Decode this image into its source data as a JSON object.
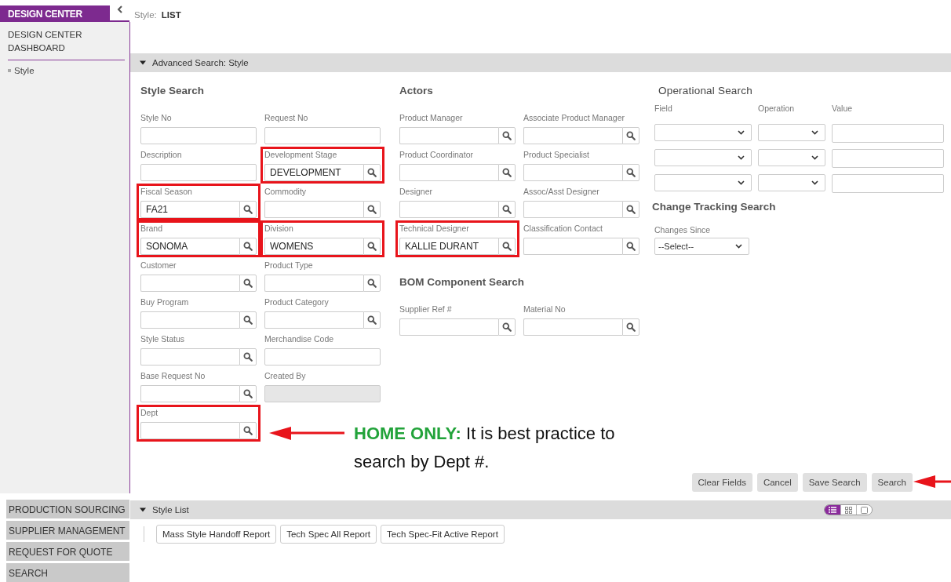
{
  "sidebar": {
    "title": "DESIGN CENTER",
    "collapsed": false,
    "items": [
      {
        "label": "DESIGN CENTER DASHBOARD",
        "kind": "link"
      },
      {
        "label": "Style",
        "kind": "bullet"
      }
    ],
    "sections": [
      "PRODUCTION SOURCING",
      "SUPPLIER MANAGEMENT",
      "REQUEST FOR QUOTE",
      "SEARCH"
    ]
  },
  "page_title": {
    "label": "Style:",
    "value": "LIST"
  },
  "advanced_search": {
    "title": "Advanced Search: Style",
    "expanded": true,
    "style_search": {
      "title": "Style Search",
      "fields": [
        {
          "label": "Style No",
          "kind": "text",
          "highlighted": false
        },
        {
          "label": "Request No",
          "kind": "text",
          "highlighted": false
        },
        {
          "label": "Description",
          "kind": "text",
          "highlighted": false
        },
        {
          "label": "Development Stage",
          "kind": "lookup",
          "value": "DEVELOPMENT",
          "highlighted": true
        },
        {
          "label": "Fiscal Season",
          "kind": "lookup",
          "value": "FA21",
          "highlighted": true
        },
        {
          "label": "Commodity",
          "kind": "lookup",
          "highlighted": false
        },
        {
          "label": "Brand",
          "kind": "lookup",
          "value": "SONOMA",
          "highlighted": true
        },
        {
          "label": "Division",
          "kind": "lookup",
          "value": "WOMENS",
          "highlighted": true
        },
        {
          "label": "Customer",
          "kind": "lookup",
          "highlighted": false
        },
        {
          "label": "Product Type",
          "kind": "lookup",
          "highlighted": false
        },
        {
          "label": "Buy Program",
          "kind": "lookup",
          "highlighted": false
        },
        {
          "label": "Product Category",
          "kind": "lookup",
          "highlighted": false
        },
        {
          "label": "Style Status",
          "kind": "lookup",
          "highlighted": false
        },
        {
          "label": "Merchandise Code",
          "kind": "text",
          "highlighted": false
        },
        {
          "label": "Base Request No",
          "kind": "lookup",
          "highlighted": false
        },
        {
          "label": "Created By",
          "kind": "disabled",
          "highlighted": false
        },
        {
          "label": "Dept",
          "kind": "lookup",
          "highlighted": true
        }
      ]
    },
    "actors": {
      "title": "Actors",
      "fields": [
        {
          "label": "Product Manager",
          "kind": "lookup",
          "highlighted": false
        },
        {
          "label": "Associate Product Manager",
          "kind": "lookup",
          "highlighted": false
        },
        {
          "label": "Product Coordinator",
          "kind": "lookup",
          "highlighted": false
        },
        {
          "label": "Product Specialist",
          "kind": "lookup",
          "highlighted": false
        },
        {
          "label": "Designer",
          "kind": "lookup",
          "highlighted": false
        },
        {
          "label": "Assoc/Asst Designer",
          "kind": "lookup",
          "highlighted": false
        },
        {
          "label": "Technical Designer",
          "kind": "lookup",
          "value": "KALLIE DURANT",
          "highlighted": true
        },
        {
          "label": "Classification Contact",
          "kind": "lookup",
          "highlighted": false
        }
      ]
    },
    "bom_search": {
      "title": "BOM Component Search",
      "fields": [
        {
          "label": "Supplier Ref #",
          "kind": "lookup",
          "highlighted": false
        },
        {
          "label": "Material No",
          "kind": "lookup",
          "highlighted": false
        }
      ]
    },
    "operational_search": {
      "title": "Operational Search",
      "columns": [
        "Field",
        "Operation",
        "Value"
      ],
      "rows": [
        {
          "kind": "criteria"
        },
        {
          "kind": "criteria"
        },
        {
          "kind": "criteria"
        }
      ]
    },
    "change_tracking": {
      "title": "Change Tracking Search",
      "label": "Changes Since",
      "value": "--Select--"
    },
    "buttons": [
      "Clear Fields",
      "Cancel",
      "Save Search",
      "Search"
    ]
  },
  "callout": {
    "text": "**HOME ONLY:** It is best practice to search by Dept #."
  },
  "style_list": {
    "title": "Style List",
    "expanded": true,
    "view_modes": [
      {
        "kind": "list",
        "selected": true
      },
      {
        "kind": "grid",
        "selected": false
      },
      {
        "kind": "single",
        "selected": false
      }
    ],
    "reports": [
      "Mass Style Handoff Report",
      "Tech Spec All Report",
      "Tech Spec-Fit Active Report"
    ]
  }
}
